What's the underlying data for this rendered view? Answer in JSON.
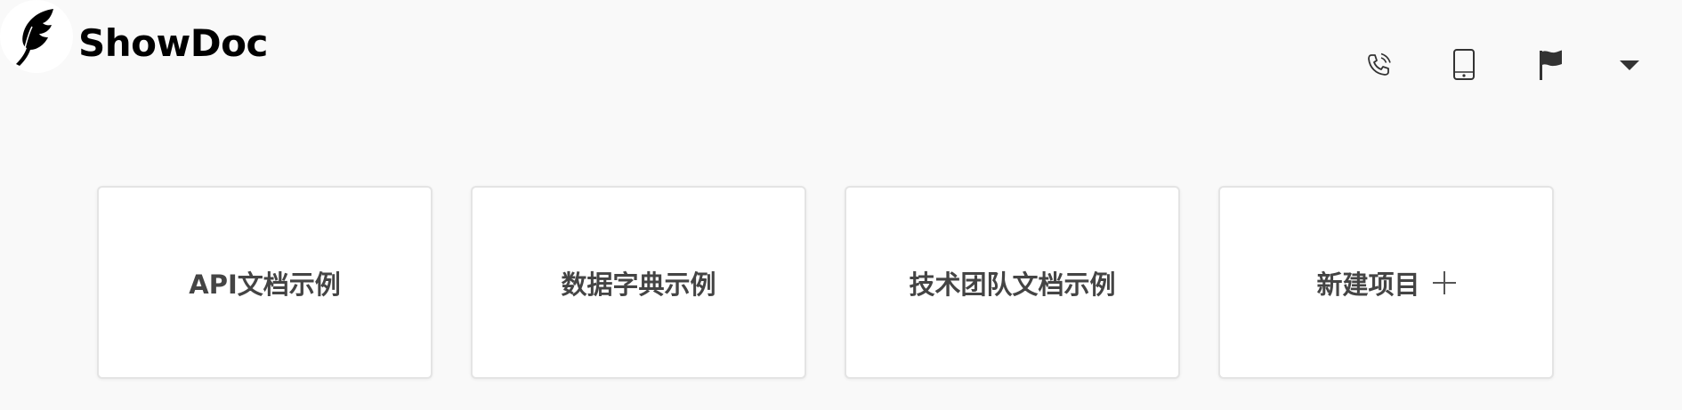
{
  "app": {
    "brand_name": "ShowDoc",
    "logo_icon": "feather-icon"
  },
  "header": {
    "icons": [
      {
        "name": "phone-icon"
      },
      {
        "name": "tablet-icon"
      },
      {
        "name": "flag-icon"
      },
      {
        "name": "caret-down-icon"
      }
    ]
  },
  "projects": [
    {
      "label": "API文档示例"
    },
    {
      "label": "数据字典示例"
    },
    {
      "label": "技术团队文档示例"
    },
    {
      "label": "新建项目",
      "icon": "plus-icon"
    }
  ],
  "colors": {
    "background": "#f9f9f9",
    "card_background": "#ffffff",
    "card_border": "#e4e4e4",
    "text": "#444444",
    "brand_text": "#000000"
  }
}
